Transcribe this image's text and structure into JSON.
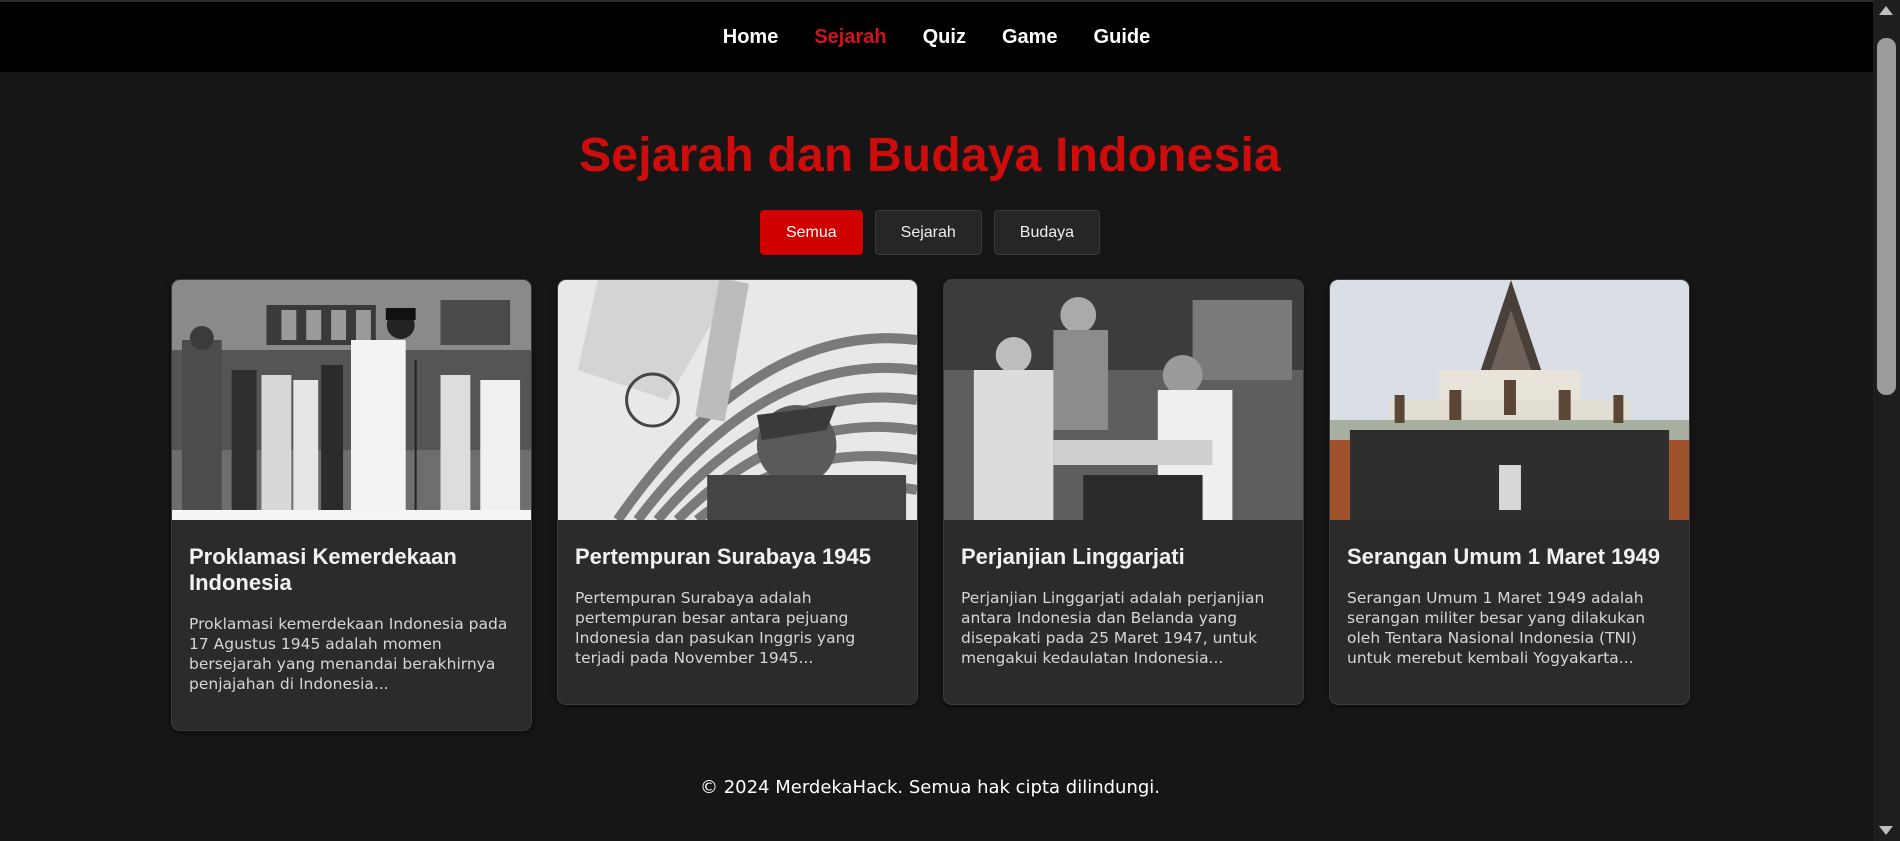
{
  "nav": {
    "items": [
      {
        "label": "Home",
        "active": false
      },
      {
        "label": "Sejarah",
        "active": true
      },
      {
        "label": "Quiz",
        "active": false
      },
      {
        "label": "Game",
        "active": false
      },
      {
        "label": "Guide",
        "active": false
      }
    ]
  },
  "page": {
    "title": "Sejarah dan Budaya Indonesia"
  },
  "filters": {
    "items": [
      {
        "label": "Semua",
        "active": true
      },
      {
        "label": "Sejarah",
        "active": false
      },
      {
        "label": "Budaya",
        "active": false
      }
    ]
  },
  "cards": [
    {
      "title": "Proklamasi Kemerdekaan Indonesia",
      "description": "Proklamasi kemerdekaan Indonesia pada 17 Agustus 1945 adalah momen bersejarah yang menandai berakhirnya penjajahan di Indonesia...",
      "image": "proclamation-photo"
    },
    {
      "title": "Pertempuran Surabaya 1945",
      "description": "Pertempuran Surabaya adalah pertempuran besar antara pejuang Indonesia dan pasukan Inggris yang terjadi pada November 1945...",
      "image": "surabaya-battle-photo"
    },
    {
      "title": "Perjanjian Linggarjati",
      "description": "Perjanjian Linggarjati adalah perjanjian antara Indonesia dan Belanda yang disepakati pada 25 Maret 1947, untuk mengakui kedaulatan Indonesia...",
      "image": "linggarjati-handshake-photo"
    },
    {
      "title": "Serangan Umum 1 Maret 1949",
      "description": "Serangan Umum 1 Maret 1949 adalah serangan militer besar yang dilakukan oleh Tentara Nasional Indonesia (TNI) untuk merebut kembali Yogyakarta...",
      "image": "monument-photo"
    }
  ],
  "footer": {
    "text": "© 2024 MerdekaHack. Semua hak cipta dilindungi."
  },
  "colors": {
    "accent": "#cf0c0c",
    "background": "#161616",
    "nav_background": "#000000",
    "card_background": "#2b2b2b"
  }
}
